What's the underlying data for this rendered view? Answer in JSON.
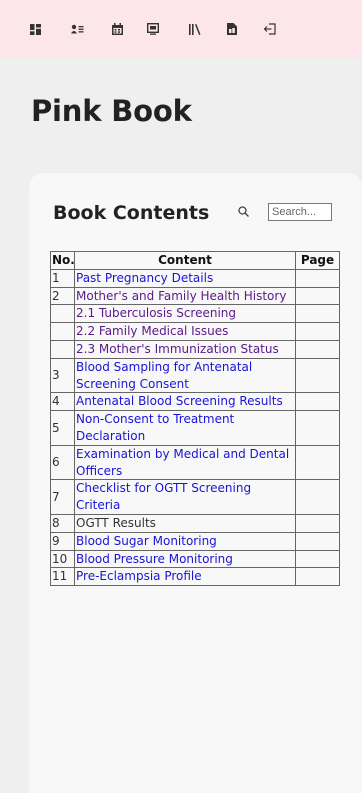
{
  "nav": {
    "icons": [
      "dashboard-icon",
      "profile-list-icon",
      "calendar-icon",
      "monitor-icon",
      "library-icon",
      "document-icon",
      "logout-icon"
    ]
  },
  "page": {
    "title": "Pink Book"
  },
  "book_contents": {
    "title": "Book Contents",
    "search_placeholder": "Search...",
    "columns": [
      "No.",
      "Content",
      "Page"
    ],
    "rows": [
      {
        "no": "1",
        "content": "Past Pregnancy Details",
        "page": "",
        "style": "link"
      },
      {
        "no": "2",
        "content": "Mother's and Family Health History",
        "page": "",
        "style": "visited"
      },
      {
        "no": "",
        "content": "2.1 Tuberculosis Screening",
        "page": "",
        "style": "visited"
      },
      {
        "no": "",
        "content": "2.2 Family Medical Issues",
        "page": "",
        "style": "visited"
      },
      {
        "no": "",
        "content": "2.3 Mother's Immunization Status",
        "page": "",
        "style": "visited"
      },
      {
        "no": "3",
        "content": "Blood Sampling for Antenatal Screening Consent",
        "page": "",
        "style": "link"
      },
      {
        "no": "4",
        "content": "Antenatal Blood Screening Results",
        "page": "",
        "style": "link"
      },
      {
        "no": "5",
        "content": "Non-Consent to Treatment Declaration",
        "page": "",
        "style": "link"
      },
      {
        "no": "6",
        "content": "Examination by Medical and Dental Officers",
        "page": "",
        "style": "link"
      },
      {
        "no": "7",
        "content": "Checklist for OGTT Screening Criteria",
        "page": "",
        "style": "link"
      },
      {
        "no": "8",
        "content": "OGTT Results",
        "page": "",
        "style": "plain"
      },
      {
        "no": "9",
        "content": "Blood Sugar Monitoring",
        "page": "",
        "style": "link"
      },
      {
        "no": "10",
        "content": "Blood Pressure Monitoring",
        "page": "",
        "style": "link"
      },
      {
        "no": "11",
        "content": "Pre-Eclampsia Profile",
        "page": "",
        "style": "link"
      }
    ]
  }
}
